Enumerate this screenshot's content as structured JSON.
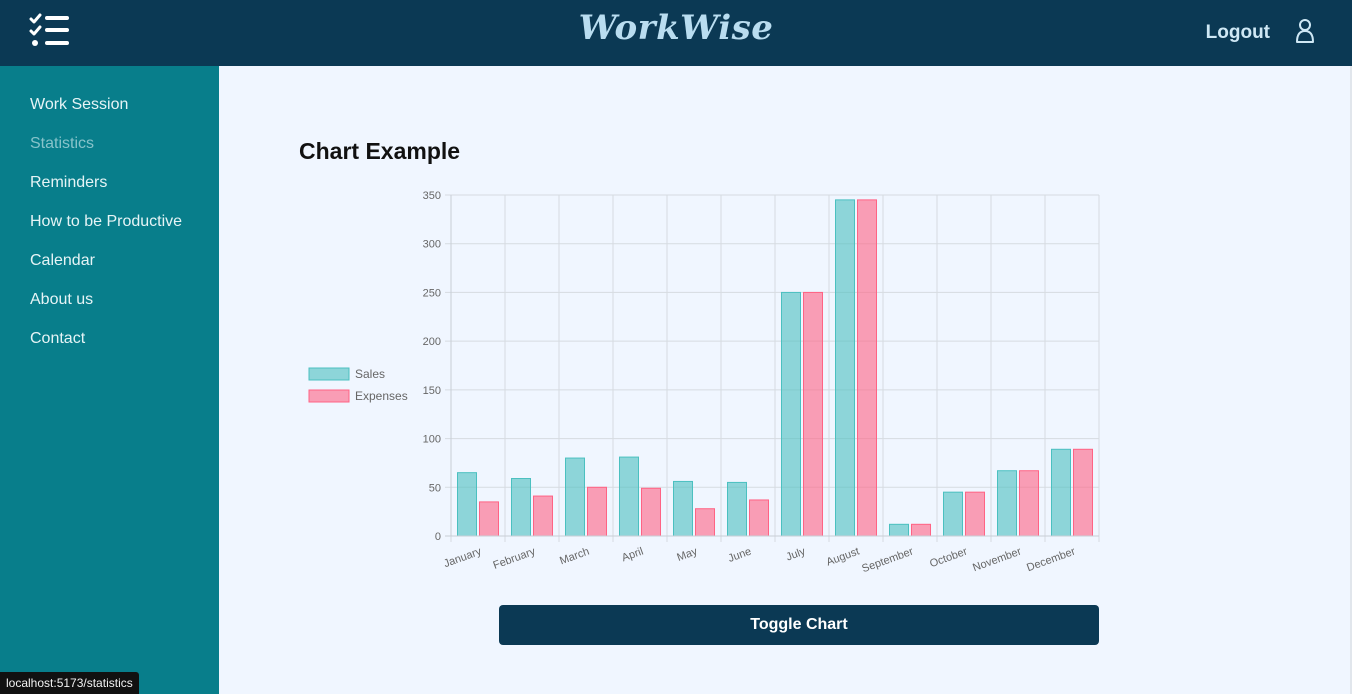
{
  "app": {
    "brand": "WorkWise",
    "logout_label": "Logout"
  },
  "icons": {
    "menu": "checklist-menu-icon",
    "user": "user-icon"
  },
  "colors": {
    "header": "#0b3954",
    "sidebar": "#087e8b",
    "content_bg": "#f0f6ff",
    "sales": "#4bc0c0",
    "expenses": "#ff6384"
  },
  "sidebar": {
    "items": [
      {
        "label": "Work Session"
      },
      {
        "label": "Statistics",
        "active": true
      },
      {
        "label": "Reminders"
      },
      {
        "label": "How to be Productive"
      },
      {
        "label": "Calendar"
      },
      {
        "label": "About us"
      },
      {
        "label": "Contact"
      }
    ]
  },
  "main": {
    "chart_heading": "Chart Example",
    "toggle_label": "Toggle Chart"
  },
  "status_bar": {
    "url": "localhost:5173/statistics"
  },
  "chart_data": {
    "type": "bar",
    "categories": [
      "January",
      "February",
      "March",
      "April",
      "May",
      "June",
      "July",
      "August",
      "September",
      "October",
      "November",
      "December"
    ],
    "series": [
      {
        "name": "Sales",
        "color": "#4bc0c0",
        "values": [
          65,
          59,
          80,
          81,
          56,
          55,
          250,
          345,
          12,
          45,
          67,
          89
        ]
      },
      {
        "name": "Expenses",
        "color": "#ff6384",
        "values": [
          35,
          41,
          50,
          49,
          28,
          37,
          250,
          345,
          12,
          45,
          67,
          89
        ]
      }
    ],
    "ylim": [
      0,
      350
    ],
    "yticks": [
      0,
      50,
      100,
      150,
      200,
      250,
      300,
      350
    ],
    "grid": true,
    "legend_position": "left"
  }
}
